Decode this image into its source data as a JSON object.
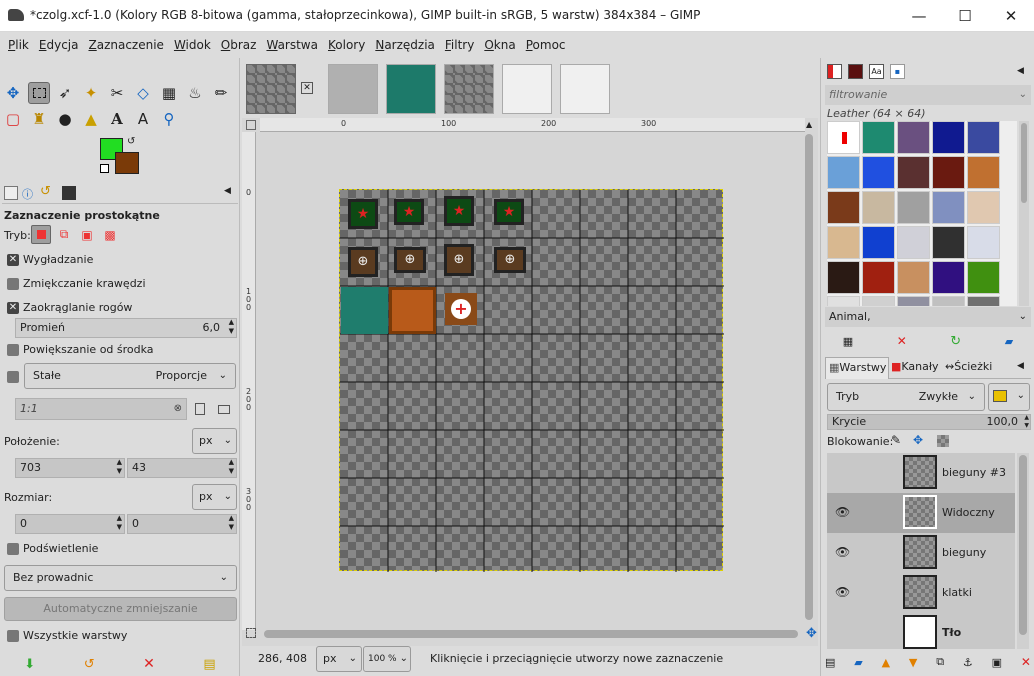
{
  "window": {
    "title": "*czolg.xcf-1.0 (Kolory RGB 8-bitowa (gamma, stałoprzecinkowa), GIMP built-in sRGB, 5 warstw) 384x384 – GIMP"
  },
  "menu": [
    "Plik",
    "Edycja",
    "Zaznaczenie",
    "Widok",
    "Obraz",
    "Warstwa",
    "Kolory",
    "Narzędzia",
    "Filtry",
    "Okna",
    "Pomoc"
  ],
  "tool_options": {
    "title": "Zaznaczenie prostokątne",
    "mode_label": "Tryb:",
    "antialias": "Wygładzanie",
    "feather": "Zmiękczanie krawędzi",
    "rounded": "Zaokrąglanie rogów",
    "radius_label": "Promień",
    "radius_value": "6,0",
    "expand": "Powiększanie od środka",
    "fixed_label": "Stałe",
    "fixed_value": "Proporcje",
    "ratio": "1:1",
    "position_label": "Położenie:",
    "unit": "px",
    "pos_x": "703",
    "pos_y": "43",
    "size_label": "Rozmiar:",
    "size_w": "0",
    "size_h": "0",
    "highlight": "Podświetlenie",
    "guides": "Bez prowadnic",
    "autoshrink": "Automatyczne zmniejszanie",
    "all_layers": "Wszystkie warstwy"
  },
  "rulers": {
    "h": [
      "0",
      "100",
      "200",
      "300"
    ],
    "v": [
      "0",
      "1 0 0",
      "2 0 0",
      "3 0 0"
    ]
  },
  "status": {
    "coords": "286, 408",
    "unit": "px",
    "zoom": "100 %",
    "message": "Kliknięcie i przeciągnięcie utworzy nowe zaznaczenie"
  },
  "patterns": {
    "filter_placeholder": "filtrowanie",
    "selected": "Leather (64 × 64)",
    "tag": "Animal,"
  },
  "layers_tabs": [
    "Warstwy",
    "Kanały",
    "Ścieżki"
  ],
  "layers": {
    "mode_label": "Tryb",
    "mode_value": "Zwykłe",
    "opacity_label": "Krycie",
    "opacity_value": "100,0",
    "lock_label": "Blokowanie:",
    "items": [
      {
        "name": "bieguny #3",
        "visible": false
      },
      {
        "name": "Widoczny",
        "visible": true
      },
      {
        "name": "bieguny",
        "visible": true
      },
      {
        "name": "klatki",
        "visible": true
      },
      {
        "name": "Tło",
        "visible": false
      }
    ]
  },
  "colors": {
    "fg": "#22dd22",
    "bg": "#7a3a08",
    "accent": "#cc2222"
  }
}
